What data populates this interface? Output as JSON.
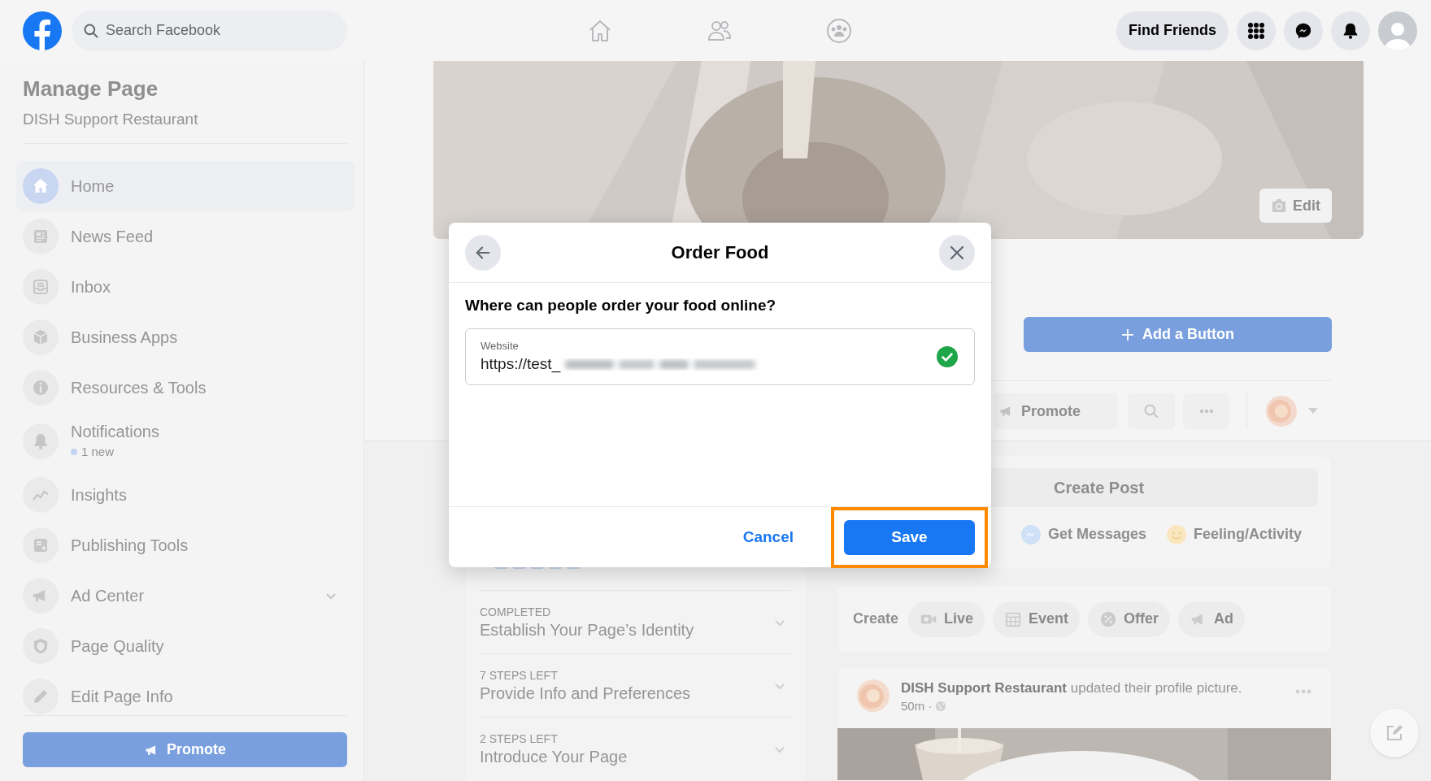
{
  "top_bar": {
    "search": {
      "placeholder": "Search Facebook"
    },
    "find_friends": "Find Friends"
  },
  "sidebar": {
    "title": "Manage Page",
    "subtitle": "DISH Support Restaurant",
    "items": [
      {
        "label": "Home",
        "kind": "link",
        "selected": true
      },
      {
        "label": "News Feed",
        "kind": "link",
        "selected": false
      },
      {
        "label": "Inbox",
        "kind": "link",
        "selected": false
      },
      {
        "label": "Business Apps",
        "kind": "link",
        "selected": false
      },
      {
        "label": "Resources & Tools",
        "kind": "link",
        "selected": false
      },
      {
        "label": "Notifications",
        "kind": "link",
        "selected": false,
        "badge": "1 new"
      },
      {
        "label": "Insights",
        "kind": "link",
        "selected": false
      },
      {
        "label": "Publishing Tools",
        "kind": "link",
        "selected": false
      },
      {
        "label": "Ad Center",
        "kind": "group",
        "selected": false
      },
      {
        "label": "Page Quality",
        "kind": "link",
        "selected": false
      },
      {
        "label": "Edit Page Info",
        "kind": "link",
        "selected": false
      }
    ],
    "promote": "Promote"
  },
  "cover": {
    "edit": "Edit"
  },
  "page_actions": {
    "add_button": "Add a Button",
    "promote": "Promote"
  },
  "setup_steps": [
    {
      "status": "COMPLETED",
      "title": "Establish Your Page’s Identity"
    },
    {
      "status": "7 STEPS LEFT",
      "title": "Provide Info and Preferences"
    },
    {
      "status": "2 STEPS LEFT",
      "title": "Introduce Your Page"
    }
  ],
  "create_post": {
    "title": "Create Post",
    "actions": [
      "Get Messages",
      "Feeling/Activity"
    ]
  },
  "create_bar": {
    "label": "Create",
    "items": [
      "Live",
      "Event",
      "Offer",
      "Ad"
    ]
  },
  "post": {
    "headline": "**DISH Support Restaurant** updated their profile picture.",
    "time": "50m ·"
  },
  "dialog": {
    "title": "Order Food",
    "question": "Where can people order your food online?",
    "field": {
      "label": "Website",
      "value": "https://test_",
      "valid": true
    },
    "buttons": [
      {
        "label": "Cancel",
        "kind": "link",
        "highlighted": false
      },
      {
        "label": "Save",
        "kind": "primary",
        "highlighted": true
      }
    ]
  }
}
